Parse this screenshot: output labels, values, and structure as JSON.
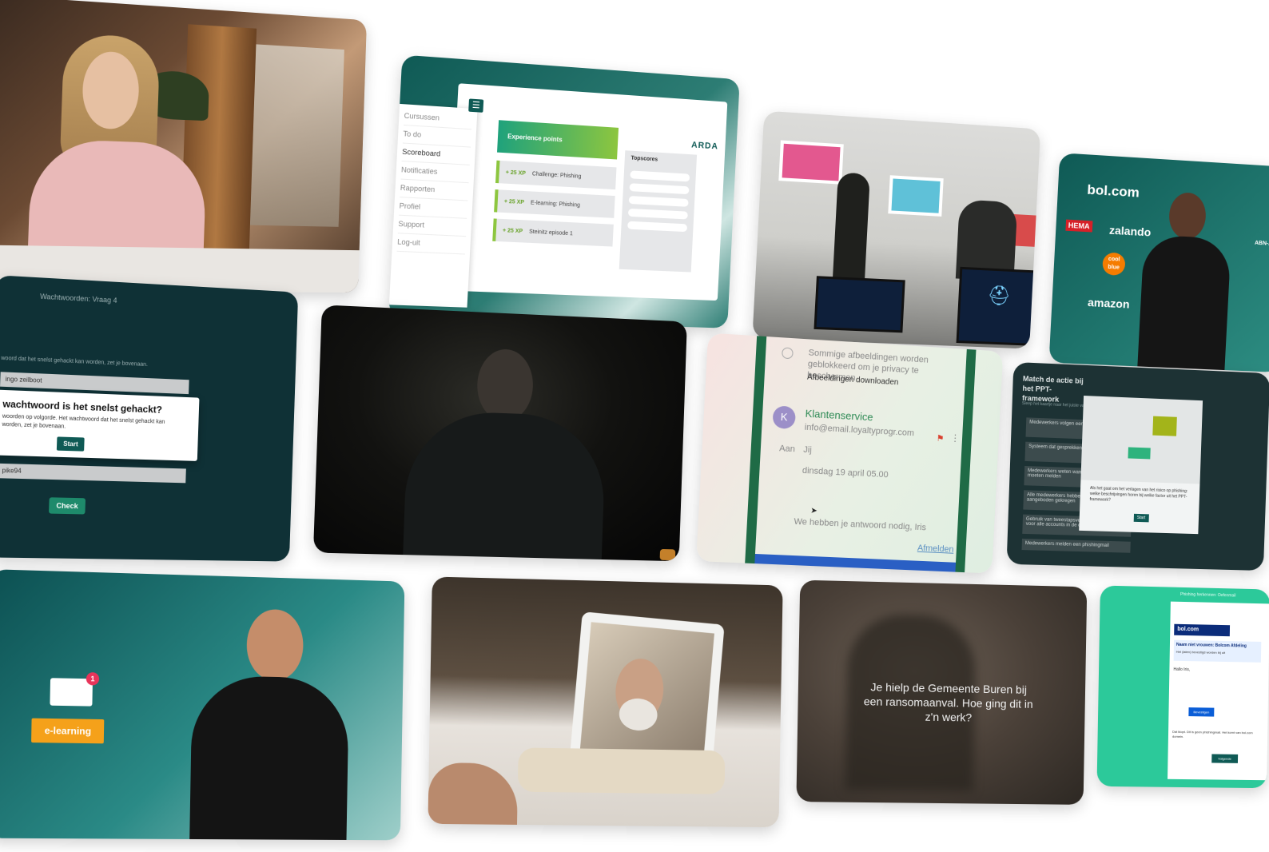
{
  "dashboard": {
    "menu": [
      "Cursussen",
      "To do",
      "Scoreboard",
      "Notificaties",
      "Rapporten",
      "Profiel",
      "Support",
      "Log-uit"
    ],
    "experience_title": "Experience points",
    "xp_items": [
      {
        "points": "+ 25 XP",
        "label": "Challenge: Phishing"
      },
      {
        "points": "+ 25 XP",
        "label": "E-learning: Phishing"
      },
      {
        "points": "+ 25 XP",
        "label": "Steinitz episode 1"
      }
    ],
    "topscores_title": "Topscores",
    "logo": "ARDA",
    "menu_icon": "hamburger-icon"
  },
  "quiz": {
    "header": "Wachtwoorden: Vraag 4",
    "instruction": "woord dat het snelst gehackt kan worden, zet je bovenaan.",
    "row1": "ingo zeilboot",
    "row2": "pike94",
    "modal_title": "wachtwoord is het snelst gehackt?",
    "modal_text": "woorden op volgorde. Het wachtwoord dat het snelst gehackt kan worden, zet je bovenaan.",
    "start_label": "Start",
    "check_label": "Check"
  },
  "brands": {
    "items": [
      "bol.com",
      "HEMA",
      "zalando",
      "cool blue",
      "amazon",
      "ABN-AMRO"
    ]
  },
  "mail": {
    "notice": "Sommige afbeeldingen worden geblokkeerd om je privacy te beschermen",
    "download_link": "Afbeeldingen downloaden",
    "avatar_letter": "K",
    "sender": "Klantenservice",
    "sender_email": "info@email.loyaltyprogr.com",
    "to_label": "Aan",
    "to_value": "Jij",
    "date": "dinsdag 19 april 05.00",
    "body": "We hebben je antwoord nodig, Iris",
    "unsubscribe": "Afmelden"
  },
  "match": {
    "title": "Match de actie bij het PPT-framework",
    "subtitle": "Sleep het kaartje naar het juiste vak",
    "items": [
      "Medewerkers volgen een training",
      "Systeem dat gesprekken opneemt",
      "Medewerkers weten wanneer een phishingmail moeten melden",
      "Alle medewerkers hebben een training aangeboden gekregen",
      "Gebruik van tweestapsverificatie is verplicht voor alle accounts in de organisatie",
      "Medewerkers melden een phishingmail"
    ],
    "modal_text": "Als het gaat om het verlagen van het risico op phishing: welke beschrijvingen horen bij welke factor uit het PPT-framework?",
    "start_label": "Start"
  },
  "elearning": {
    "badge_count": "1",
    "label": "e-learning"
  },
  "caption": {
    "text": "Je hielp de Gemeente Buren bij een ransomaanval. Hoe ging dit in z'n werk?"
  },
  "phishing_mail": {
    "header": "Phishing herkennen: Oefenmail",
    "brand": "bol.com",
    "banner": "Naam niet vrouwen: Bolcom Afdeling",
    "banner_sub": "Het (laten) bevestigd worden bij uit",
    "greeting": "Hallo Iris,",
    "cta": "Bevestigen",
    "footer": "Dat klopt. Dit is geen phishingmail. Het komt van bol.com domein.",
    "next_label": "Volgende"
  }
}
